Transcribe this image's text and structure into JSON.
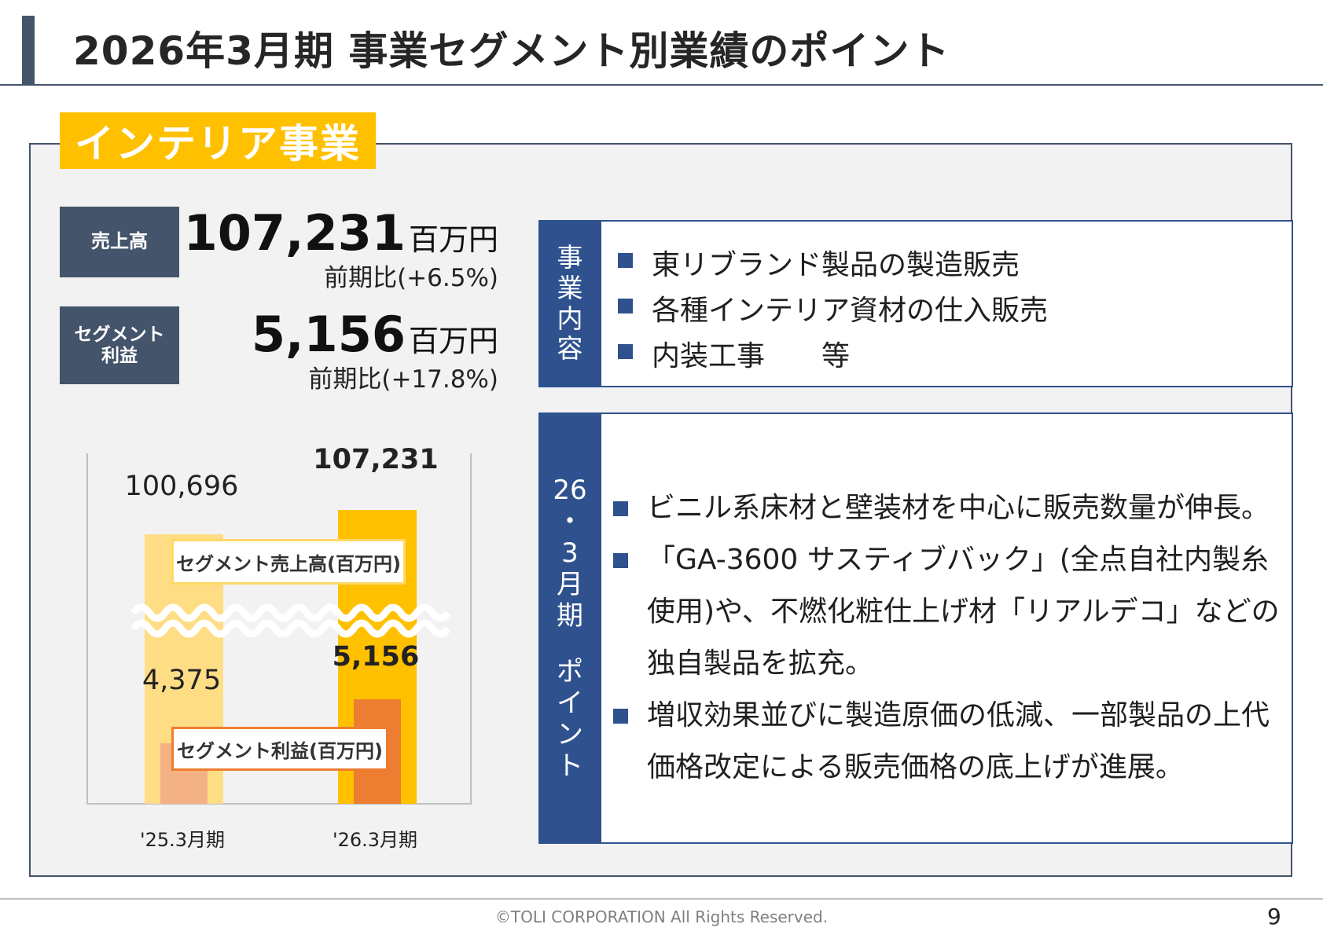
{
  "header": {
    "title": "2026年3月期  事業セグメント別業績のポイント"
  },
  "segment": {
    "name": "インテリア事業"
  },
  "kpis": [
    {
      "label": "売上高",
      "value": "107,231",
      "unit": "百万円",
      "comparison": "前期比(+6.5%)"
    },
    {
      "label": "セグメント利益",
      "value": "5,156",
      "unit": "百万円",
      "comparison": "前期比(+17.8%)"
    }
  ],
  "business_content": {
    "side_label": "事業内容",
    "items": [
      "東リブランド製品の製造販売",
      "各種インテリア資材の仕入販売",
      "内装工事　　等"
    ]
  },
  "points": {
    "side_label_top": "26・3月期",
    "side_label_bottom": "ポイント",
    "items": [
      "ビニル系床材と壁装材を中心に販売数量が伸長。",
      "「GA-3600 サスティブバック」(全点自社内製糸使用)や、不燃化粧仕上げ材「リアルデコ」などの独自製品を拡充。",
      "増収効果並びに製造原価の低減、一部製品の上代価格改定による販売価格の底上げが進展。"
    ]
  },
  "chart_data": {
    "type": "bar",
    "categories": [
      "'25.3月期",
      "'26.3月期"
    ],
    "series": [
      {
        "name": "セグメント売上高(百万円)",
        "values": [
          100696
        ],
        "labels": [
          "100,696",
          "107,231"
        ],
        "all_values": [
          100696,
          107231
        ],
        "colors": [
          "#ffdd85",
          "#ffc000"
        ]
      },
      {
        "name": "セグメント利益(百万円)",
        "values": [
          4375
        ],
        "labels": [
          "4,375",
          "5,156"
        ],
        "all_values": [
          4375,
          5156
        ],
        "colors": [
          "#f4b183",
          "#ed7d31"
        ]
      }
    ],
    "axis_break": true,
    "legend_placement": "inside-bars"
  },
  "footer": {
    "copyright": "©TOLI CORPORATION All Rights Reserved.",
    "page_number": "9"
  }
}
